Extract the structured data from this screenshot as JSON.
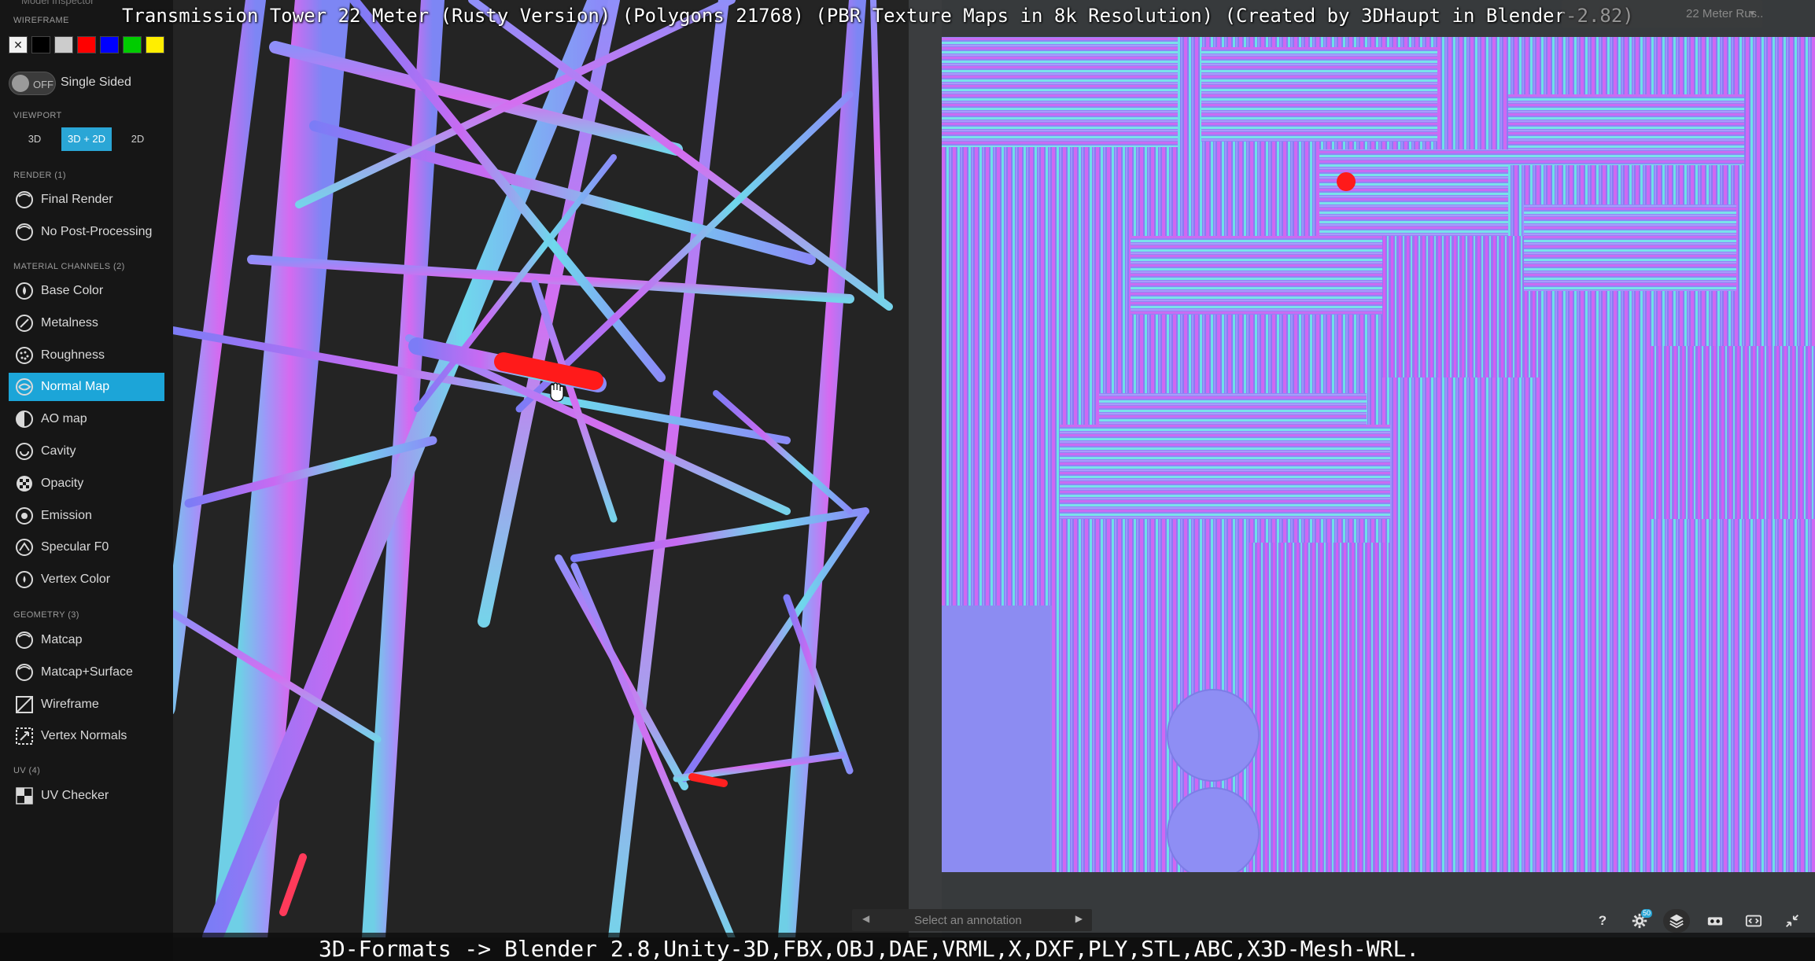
{
  "title": "Transmission Tower 22 Meter (Rusty Version) (Polygons 21768) (PBR Texture Maps in 8k Resolution) (Created by 3DHaupt in Blender-2.82)",
  "footer": "3D-Formats -> Blender 2.8,Unity-3D,FBX,OBJ,DAE,VRML,X,DXF,PLY,STL,ABC,X3D-Mesh-WRL.",
  "model_select": {
    "value": "22 Meter Rus..."
  },
  "panel": {
    "header": "Model Inspector",
    "wireframe_label": "Wireframe",
    "swatch_colors": [
      "#ffffff",
      "#000000",
      "#cccccc",
      "#ff0000",
      "#0000ff",
      "#00cc00",
      "#ffee00"
    ],
    "single_sided": {
      "toggle": "OFF",
      "label": "Single Sided"
    },
    "viewport_label": "Viewport",
    "viewport_options": [
      "3D",
      "3D + 2D",
      "2D"
    ],
    "viewport_active": "3D + 2D",
    "render_label": "Render (1)",
    "render_items": [
      "Final Render",
      "No Post-Processing"
    ],
    "material_label": "Material Channels (2)",
    "material_items": [
      "Base Color",
      "Metalness",
      "Roughness",
      "Normal Map",
      "AO map",
      "Cavity",
      "Opacity",
      "Emission",
      "Specular F0",
      "Vertex Color"
    ],
    "material_active": "Normal Map",
    "geometry_label": "Geometry (3)",
    "geometry_items": [
      "Matcap",
      "Matcap+Surface",
      "Wireframe",
      "Vertex Normals"
    ],
    "uv_label": "UV (4)",
    "uv_items": [
      "UV Checker"
    ]
  },
  "annotation": {
    "placeholder": "Select an annotation"
  },
  "toolbar": {
    "help": "?",
    "settings_badge": "50"
  },
  "colors": {
    "accent": "#1ca5d8",
    "normal_blue": "#8080ff",
    "normal_pink": "#d45cff",
    "normal_cyan": "#6fe3e6",
    "highlight": "#ff1a1a"
  }
}
